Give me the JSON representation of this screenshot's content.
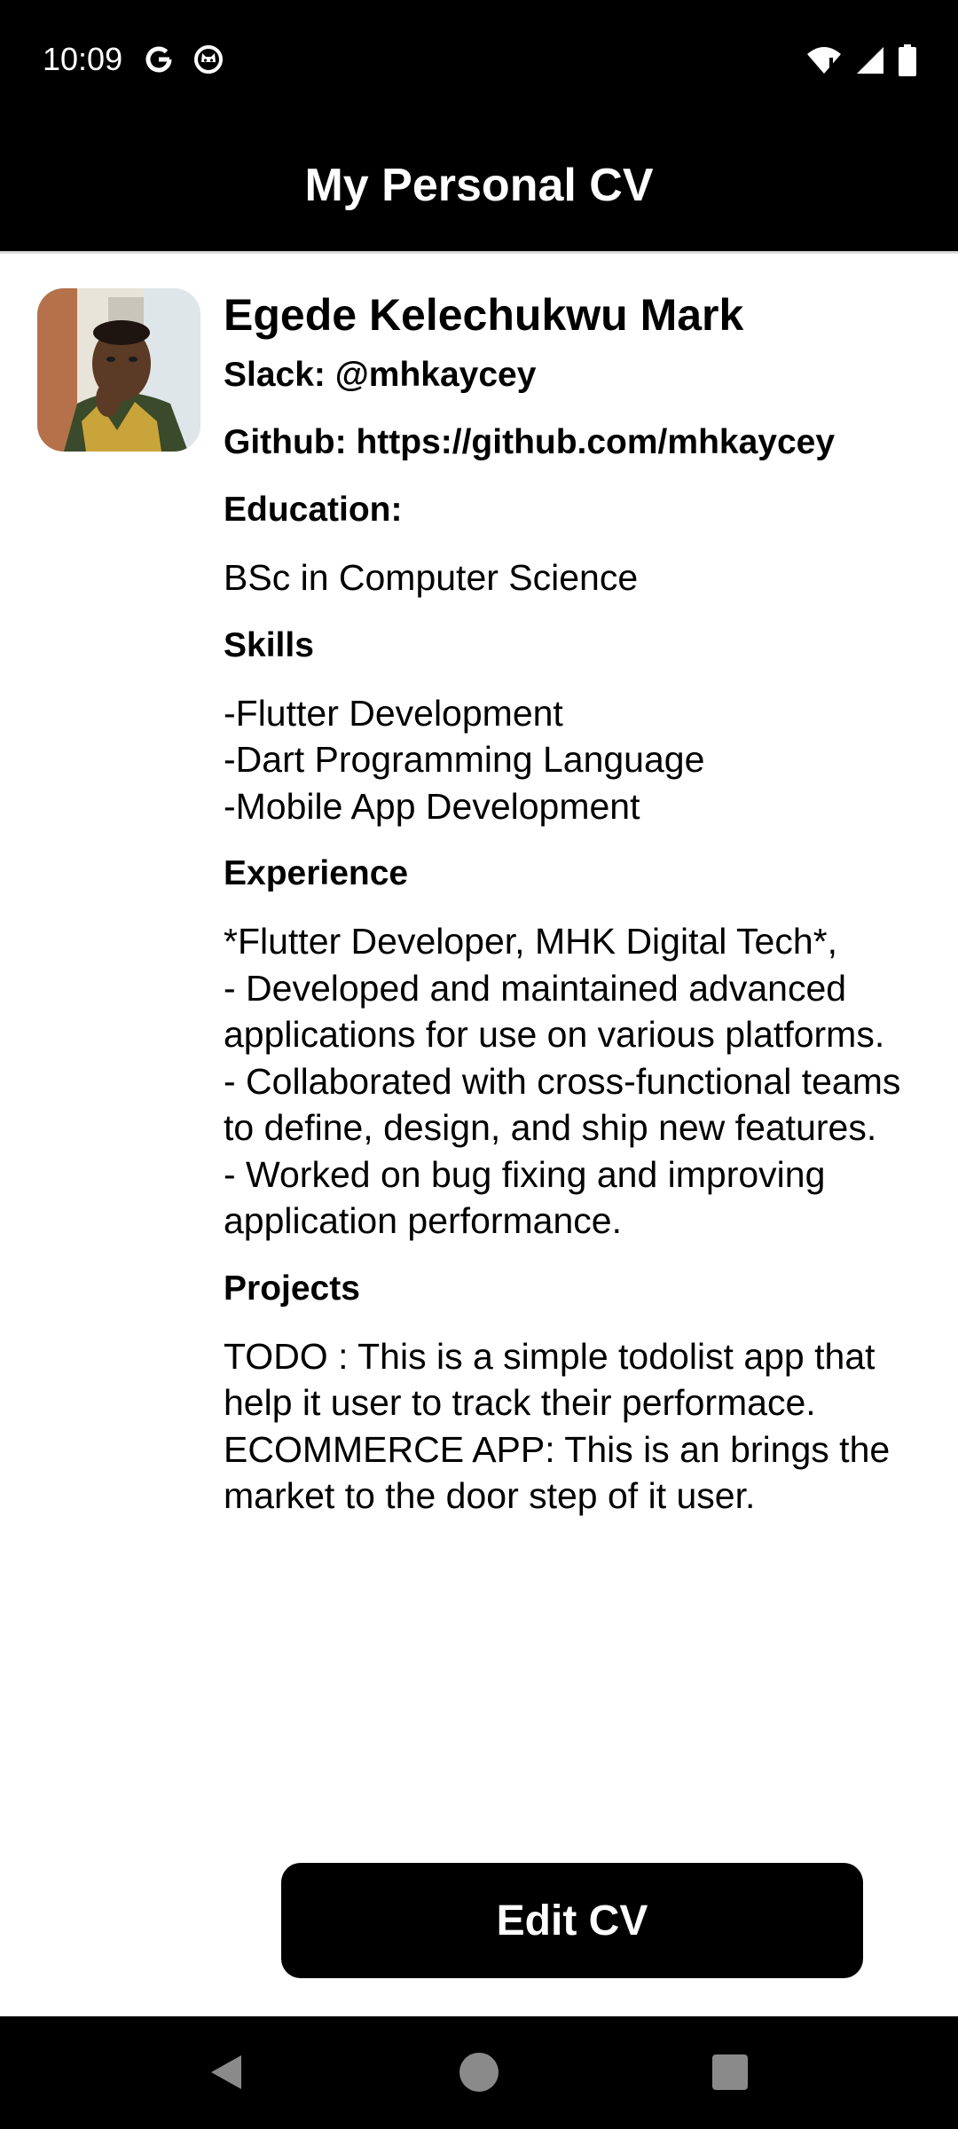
{
  "status_bar": {
    "time": "10:09",
    "left_icons": [
      "google-icon",
      "cat-icon"
    ],
    "right_icons": [
      "wifi-alert-icon",
      "signal-icon",
      "battery-icon"
    ]
  },
  "app_bar": {
    "title": "My Personal CV"
  },
  "profile": {
    "name": "Egede Kelechukwu Mark",
    "slack": "Slack: @mhkaycey",
    "github": "Github: https://github.com/mhkaycey"
  },
  "sections": {
    "education_heading": "Education:",
    "education_text": "BSc in Computer Science",
    "skills_heading": "Skills",
    "skills_text": "-Flutter Development\n-Dart Programming Language\n-Mobile App Development",
    "experience_heading": "Experience",
    "experience_text": "*Flutter Developer, MHK Digital Tech*,\n- Developed and maintained advanced applications for use on various platforms.\n- Collaborated with cross-functional teams to define, design, and ship new features.\n- Worked on bug fixing and improving application performance.",
    "projects_heading": "Projects",
    "projects_text": "TODO : This is a simple todolist app that help it user to track their performace.\nECOMMERCE APP: This is an brings the market to the door step of it user."
  },
  "actions": {
    "edit_label": "Edit CV"
  },
  "nav_bar": {
    "icons": [
      "back-icon",
      "home-icon",
      "recents-icon"
    ]
  },
  "colors": {
    "bars": "#000000",
    "background": "#ffffff",
    "button": "#000000"
  }
}
